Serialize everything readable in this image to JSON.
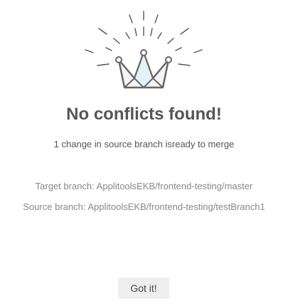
{
  "dialog": {
    "illustration": "crown-icon",
    "title": "No conflicts found!",
    "subtitle": "1 change in source branch isready to merge",
    "target_branch_label": "Target branch:",
    "target_branch": "ApplitoolsEKB/frontend-testing/master",
    "source_branch_label": "Source branch:",
    "source_branch": "ApplitoolsEKB/frontend-testing/testBranch1",
    "confirm_label": "Got it!"
  },
  "colors": {
    "text_primary": "#555555",
    "text_muted": "#888888",
    "crown_stroke": "#666666",
    "crown_fill": "#e3f2f8",
    "button_bg": "#eeeeee"
  }
}
